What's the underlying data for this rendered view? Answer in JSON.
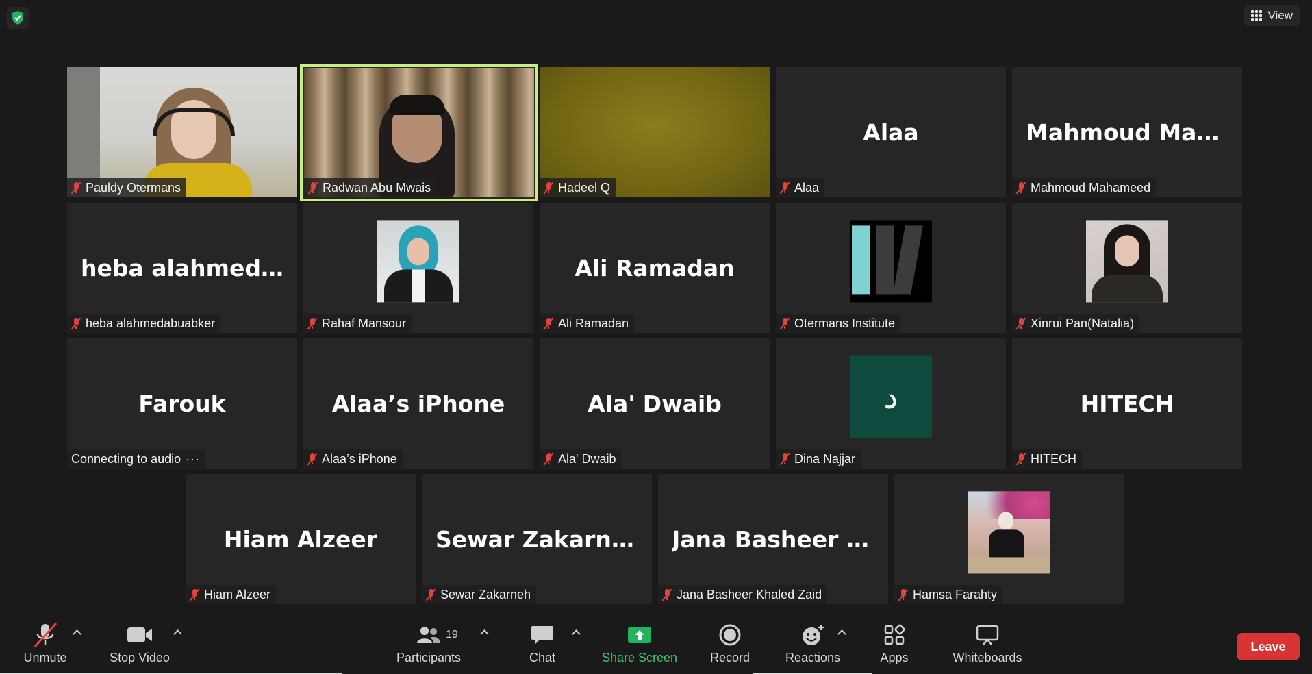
{
  "topbar": {
    "view_label": "View"
  },
  "tiles": [
    {
      "name": "Pauldy Otermans",
      "big": ""
    },
    {
      "name": "Radwan Abu Mwais",
      "big": ""
    },
    {
      "name": "Hadeel Q",
      "big": ""
    },
    {
      "name": "Alaa",
      "big": "Alaa"
    },
    {
      "name": "Mahmoud Mahameed",
      "big": "Mahmoud  Mah..."
    },
    {
      "name": "heba alahmedabuabker",
      "big": "heba  alahmeda..."
    },
    {
      "name": "Rahaf Mansour",
      "big": ""
    },
    {
      "name": "Ali Ramadan",
      "big": "Ali Ramadan"
    },
    {
      "name": "Otermans Institute",
      "big": ""
    },
    {
      "name": "Xinrui Pan(Natalia)",
      "big": ""
    },
    {
      "name": "Connecting to audio",
      "big": "Farouk"
    },
    {
      "name": "Alaa’s iPhone",
      "big": "Alaa’s iPhone"
    },
    {
      "name": "Ala' Dwaib",
      "big": "Ala' Dwaib"
    },
    {
      "name": "Dina Najjar",
      "big": "",
      "avatar_letter": "د"
    },
    {
      "name": "HITECH",
      "big": "HITECH"
    },
    {
      "name": "Hiam Alzeer",
      "big": "Hiam Alzeer"
    },
    {
      "name": "Sewar Zakarneh",
      "big": "Sewar Zakarneh"
    },
    {
      "name": "Jana Basheer Khaled Zaid",
      "big": "Jana  Basheer  K..."
    },
    {
      "name": "Hamsa Farahty",
      "big": ""
    }
  ],
  "toolbar": {
    "unmute": "Unmute",
    "stop_video": "Stop Video",
    "participants": "Participants",
    "participants_count": "19",
    "chat": "Chat",
    "share_screen": "Share Screen",
    "record": "Record",
    "reactions": "Reactions",
    "apps": "Apps",
    "whiteboards": "Whiteboards",
    "leave": "Leave"
  },
  "colors": {
    "active_speaker_border": "#c8ef7e",
    "share_green": "#3ec56b",
    "leave_red": "#d93434",
    "muted_red": "#e0433f"
  }
}
